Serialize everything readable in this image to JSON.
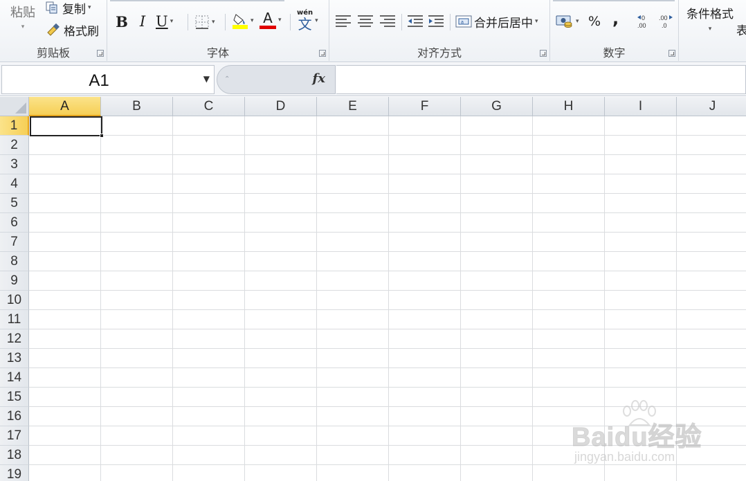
{
  "ribbon": {
    "clipboard": {
      "label": "剪贴板",
      "paste_label": "粘贴",
      "copy_label": "复制",
      "format_painter_label": "格式刷"
    },
    "font": {
      "label": "字体",
      "bold": "B",
      "italic": "I",
      "underline": "U",
      "font_color_letter": "A",
      "phonetic_top": "wén",
      "phonetic_char": "文"
    },
    "alignment": {
      "label": "对齐方式",
      "merge_center_label": "合并后居中"
    },
    "number": {
      "label": "数字",
      "percent": "%",
      "comma": ","
    },
    "styles": {
      "conditional_format_label": "条件格式",
      "table_label_partial": "表"
    },
    "colors": {
      "fill_highlight": "#ffff00",
      "font_red": "#e00000"
    }
  },
  "formula_bar": {
    "name_box_value": "A1",
    "fx_label": "fx",
    "formula_value": ""
  },
  "sheet": {
    "columns": [
      "A",
      "B",
      "C",
      "D",
      "E",
      "F",
      "G",
      "H",
      "I",
      "J"
    ],
    "rows": [
      "1",
      "2",
      "3",
      "4",
      "5",
      "6",
      "7",
      "8",
      "9",
      "10",
      "11",
      "12",
      "13",
      "14",
      "15",
      "16",
      "17",
      "18",
      "19"
    ],
    "active_column": "A",
    "active_row": "1",
    "active_color": "#f6cf56"
  },
  "watermark": {
    "logo": "Baidu经验",
    "url": "jingyan.baidu.com"
  }
}
